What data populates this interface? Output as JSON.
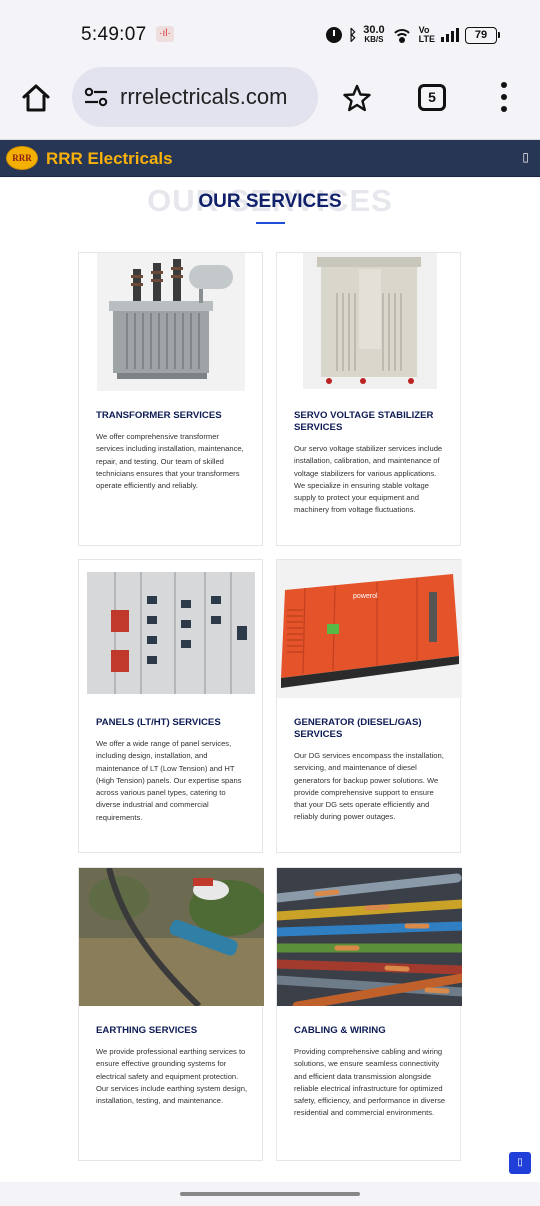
{
  "status_bar": {
    "time": "5:49:07",
    "notification_icon": "voice-recorder-icon",
    "net_speed_value": "30.0",
    "net_speed_unit": "KB/S",
    "volte_line1": "Vo",
    "volte_line2": "LTE",
    "battery": "79"
  },
  "browser": {
    "url": "rrrelectricals.com",
    "tab_count": "5"
  },
  "site_header": {
    "logo_text": "RRR",
    "brand": "RRR Electricals",
    "menu_glyph": "▯"
  },
  "services": {
    "watermark": "OUR SERVICES",
    "title": "OUR SERVICES",
    "items": [
      {
        "title": "TRANSFORMER SERVICES",
        "description": "We offer comprehensive transformer services including installation, maintenance, repair, and testing. Our team of skilled technicians ensures that your transformers operate efficiently and reliably."
      },
      {
        "title": "SERVO VOLTAGE STABILIZER SERVICES",
        "description": "Our servo voltage stabilizer services include installation, calibration, and maintenance of voltage stabilizers for various applications. We specialize in ensuring stable voltage supply to protect your equipment and machinery from voltage fluctuations."
      },
      {
        "title": "PANELS (LT/HT) SERVICES",
        "description": "We offer a wide range of panel services, including design, installation, and maintenance of LT (Low Tension) and HT (High Tension) panels. Our expertise spans across various panel types, catering to diverse industrial and commercial requirements."
      },
      {
        "title": "GENERATOR (DIESEL/GAS) SERVICES",
        "description": "Our DG services encompass the installation, servicing, and maintenance of diesel generators for backup power solutions. We provide comprehensive support to ensure that your DG sets operate efficiently and reliably during power outages."
      },
      {
        "title": "EARTHING SERVICES",
        "description": "We provide professional earthing services to ensure effective grounding systems for electrical safety and equipment protection. Our services include earthing system design, installation, testing, and maintenance."
      },
      {
        "title": "CABLING & WIRING",
        "description": "Providing comprehensive cabling and wiring solutions, we ensure seamless connectivity and efficient data transmission alongside reliable electrical infrastructure for optimized safety, efficiency, and performance in diverse residential and commercial environments."
      }
    ]
  },
  "scroll_top_glyph": "▯",
  "generator_brand": "powerol"
}
